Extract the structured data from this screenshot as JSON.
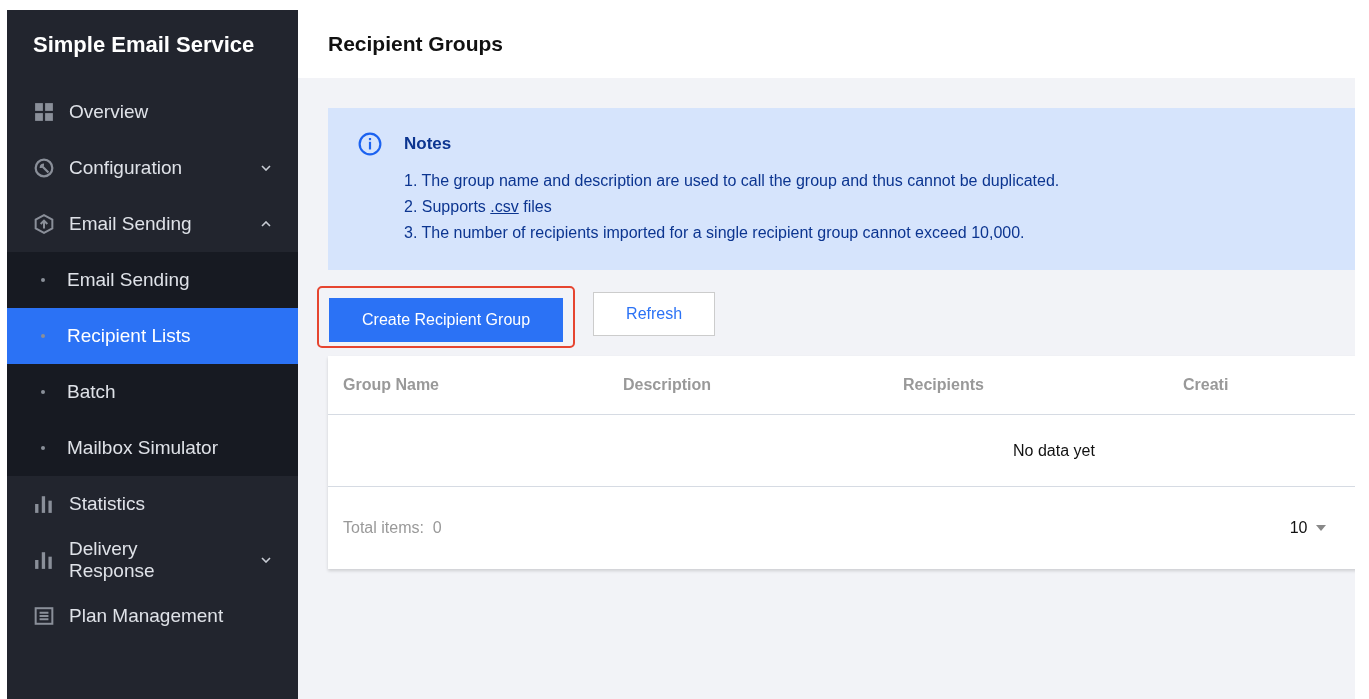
{
  "sidebar": {
    "title": "Simple Email Service",
    "items": [
      {
        "label": "Overview",
        "selected": false
      },
      {
        "label": "Configuration",
        "expanded": false,
        "selected": false
      },
      {
        "label": "Email Sending",
        "expanded": true,
        "selected": false,
        "children": [
          {
            "label": "Email Sending",
            "selected": false
          },
          {
            "label": "Recipient Lists",
            "selected": true
          },
          {
            "label": "Batch",
            "selected": false
          },
          {
            "label": "Mailbox Simulator",
            "selected": false
          }
        ]
      },
      {
        "label": "Statistics",
        "selected": false
      },
      {
        "label": "Delivery Response",
        "expanded": false,
        "selected": false
      },
      {
        "label": "Plan Management",
        "selected": false
      }
    ]
  },
  "page_title": "Recipient Groups",
  "notes": {
    "title": "Notes",
    "lines": [
      {
        "text": "1. The group name and description are used to call the group and thus cannot be duplicated."
      },
      {
        "text": "2. Supports",
        "link": ".csv",
        "after": "files"
      },
      {
        "text": "3. The number of recipients imported for a single recipient group cannot exceed 10,000."
      }
    ]
  },
  "buttons": [
    {
      "label": "Create Recipient Group",
      "kind": "primary",
      "highlighted": true
    },
    {
      "label": "Refresh",
      "kind": "secondary",
      "highlighted": false
    }
  ],
  "table": {
    "columns": [
      "Group Name",
      "Description",
      "Recipients",
      "Creati"
    ],
    "empty_text": "No data yet",
    "total_label": "Total items:",
    "total": "0",
    "page_size": "10"
  }
}
